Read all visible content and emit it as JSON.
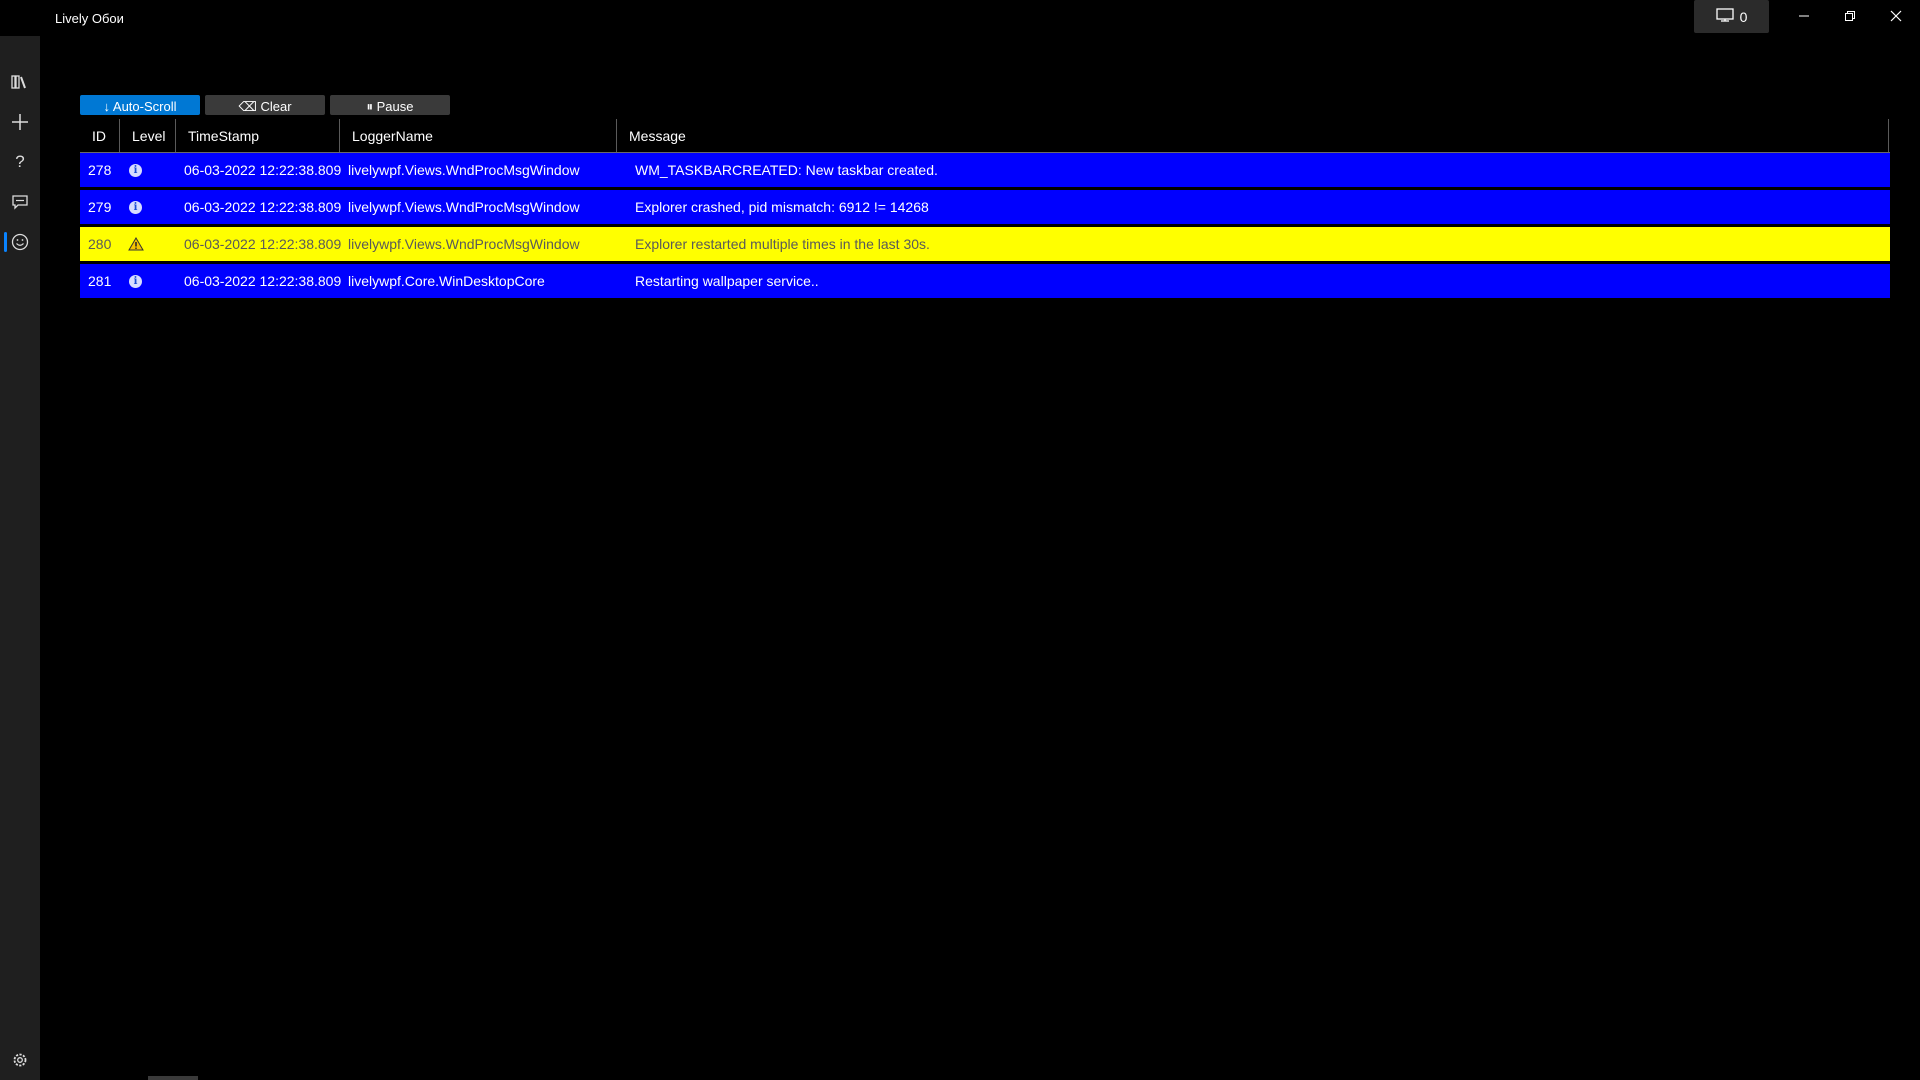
{
  "window": {
    "title": "Lively Обои",
    "monitor_count": "0"
  },
  "sidebar": {
    "items": [
      {
        "name": "library",
        "icon": "library-icon"
      },
      {
        "name": "add",
        "icon": "plus-icon"
      },
      {
        "name": "help",
        "icon": "question-icon"
      },
      {
        "name": "feedback",
        "icon": "chat-icon"
      },
      {
        "name": "debug",
        "icon": "smiley-icon",
        "active": true
      }
    ],
    "settings_icon": "gear-icon"
  },
  "toolbar": {
    "autoscroll_label": "↓ Auto-Scroll",
    "clear_label": "⌫ Clear",
    "pause_label": "⏸ Pause"
  },
  "grid": {
    "headers": {
      "id": "ID",
      "level": "Level",
      "timestamp": "TimeStamp",
      "logger": "LoggerName",
      "message": "Message"
    },
    "rows": [
      {
        "id": "278",
        "level": "info",
        "timestamp": "06-03-2022 12:22:38.809",
        "logger": "livelywpf.Views.WndProcMsgWindow",
        "message": "WM_TASKBARCREATED: New taskbar created."
      },
      {
        "id": "279",
        "level": "info",
        "timestamp": "06-03-2022 12:22:38.809",
        "logger": "livelywpf.Views.WndProcMsgWindow",
        "message": "Explorer crashed, pid mismatch: 6912 != 14268"
      },
      {
        "id": "280",
        "level": "warning",
        "timestamp": "06-03-2022 12:22:38.809",
        "logger": "livelywpf.Views.WndProcMsgWindow",
        "message": "Explorer restarted multiple times in the last 30s."
      },
      {
        "id": "281",
        "level": "info",
        "timestamp": "06-03-2022 12:22:38.809",
        "logger": "livelywpf.Core.WinDesktopCore",
        "message": "Restarting wallpaper service.."
      }
    ]
  },
  "colors": {
    "info_row": "#0000ff",
    "warning_row": "#ffff00",
    "accent": "#0078d4",
    "sidebar": "#1f1f1f"
  }
}
